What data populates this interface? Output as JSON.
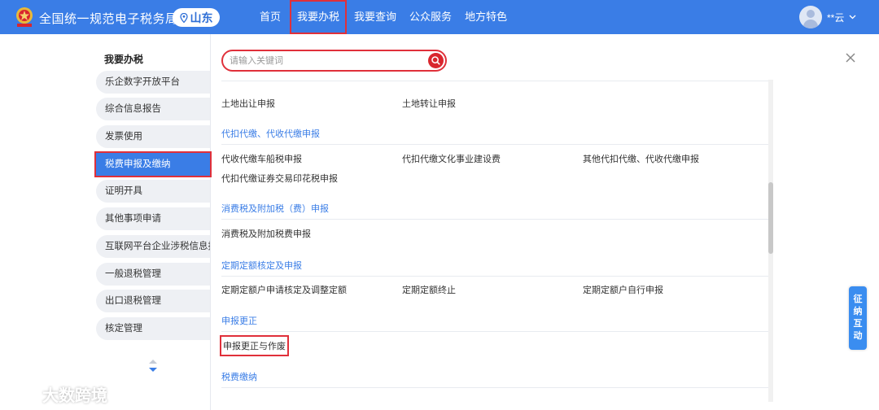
{
  "header": {
    "title": "全国统一规范电子税务局",
    "region": "山东",
    "nav": [
      "首页",
      "我要办税",
      "我要查询",
      "公众服务",
      "地方特色"
    ],
    "active_nav": "我要办税",
    "user_name": "**云"
  },
  "sidebar": {
    "title": "我要办税",
    "items": [
      {
        "label": "乐企数字开放平台",
        "active": false
      },
      {
        "label": "综合信息报告",
        "active": false
      },
      {
        "label": "发票使用",
        "active": false
      },
      {
        "label": "税费申报及缴纳",
        "active": true
      },
      {
        "label": "证明开具",
        "active": false
      },
      {
        "label": "其他事项申请",
        "active": false
      },
      {
        "label": "互联网平台企业涉税信息报送",
        "active": false
      },
      {
        "label": "一般退税管理",
        "active": false
      },
      {
        "label": "出口退税管理",
        "active": false
      },
      {
        "label": "核定管理",
        "active": false
      }
    ]
  },
  "search": {
    "placeholder": "请输入关键词",
    "value": ""
  },
  "content": {
    "top_links": [
      "土地出让申报",
      "土地转让申报"
    ],
    "sections": [
      {
        "title": "代扣代缴、代收代缴申报",
        "links": [
          "代收代缴车船税申报",
          "代扣代缴文化事业建设费",
          "其他代扣代缴、代收代缴申报",
          "代扣代缴证券交易印花税申报"
        ]
      },
      {
        "title": "消费税及附加税（费）申报",
        "links": [
          "消费税及附加税费申报"
        ]
      },
      {
        "title": "定期定额核定及申报",
        "links": [
          "定期定额户申请核定及调整定额",
          "定期定额终止",
          "定期定额户自行申报"
        ]
      },
      {
        "title": "申报更正",
        "links": [
          "申报更正与作废"
        ]
      },
      {
        "title": "税费缴纳",
        "links": []
      }
    ]
  },
  "float_tab": [
    "征",
    "纳",
    "互",
    "动"
  ],
  "watermark": "大数跨境",
  "colors": {
    "header_bg": "#3a7de6",
    "accent": "#3a7de6",
    "highlight": "#e0303a",
    "search_btn": "#d9262e"
  },
  "icons": [
    "emblem-logo",
    "location-pin-icon",
    "user-avatar-icon",
    "chevron-down-icon",
    "search-icon",
    "close-icon",
    "scroll-arrows-icon"
  ]
}
